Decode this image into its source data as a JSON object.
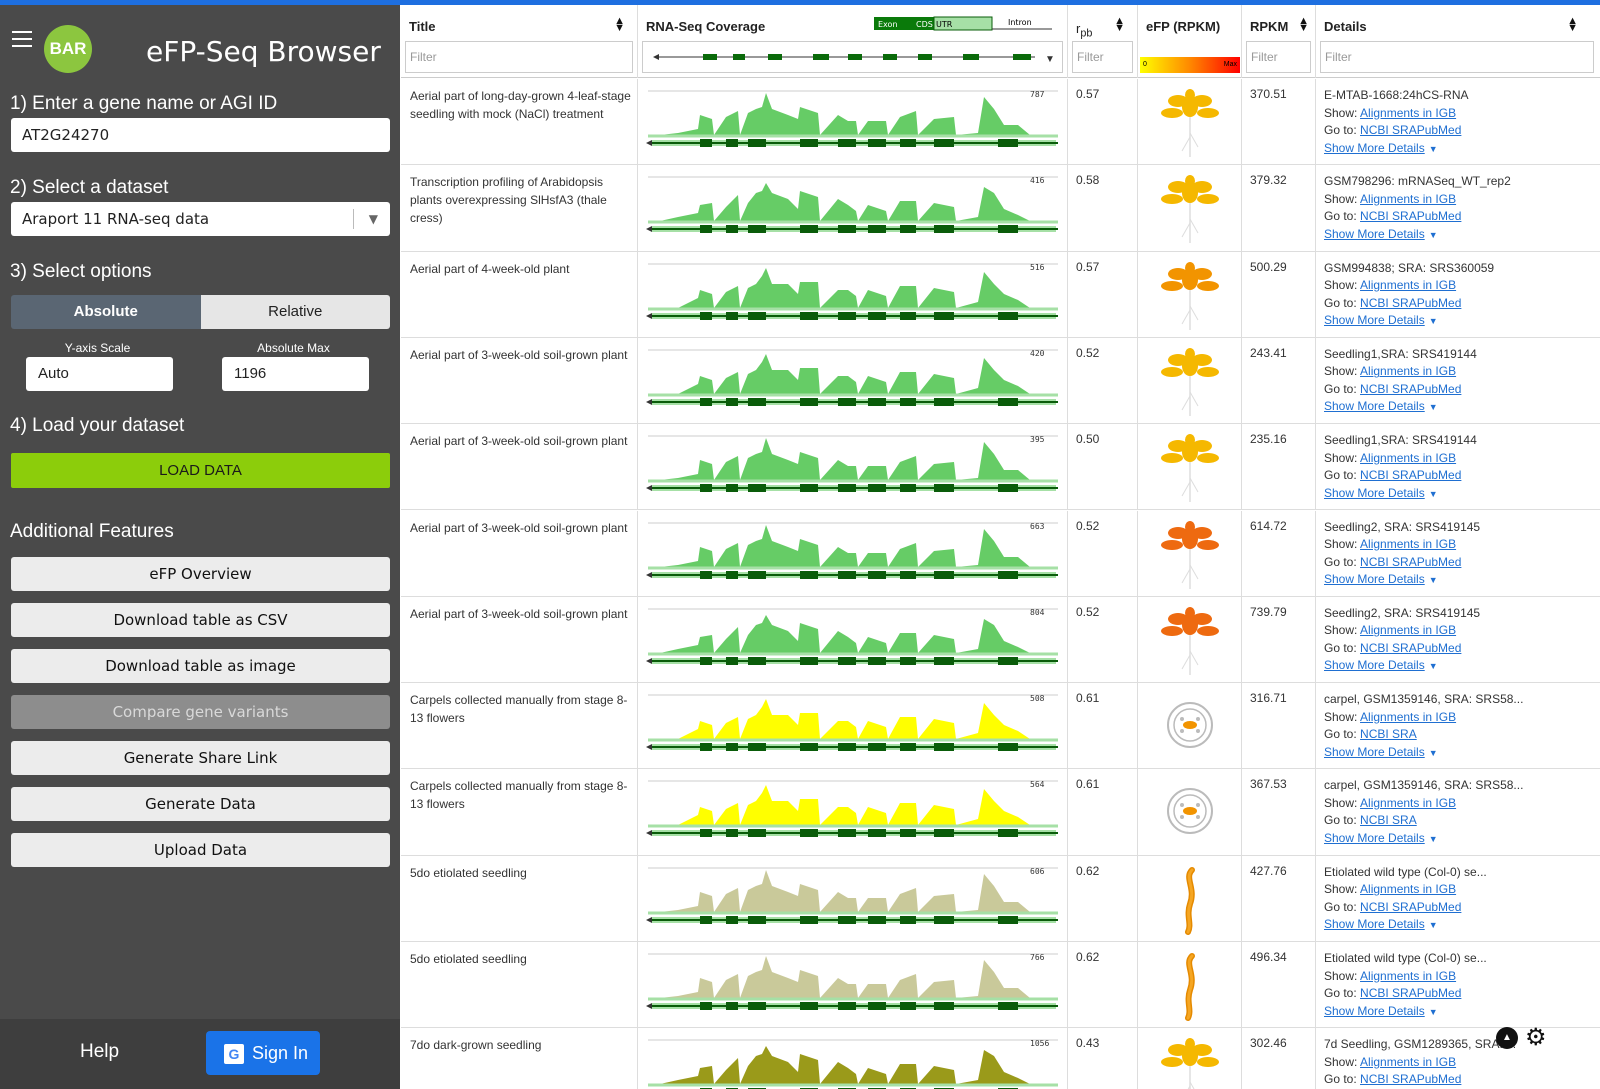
{
  "app": {
    "logo": "BAR",
    "title": "eFP-Seq Browser"
  },
  "steps": {
    "step1": "1) Enter a gene name or AGI ID",
    "gene_value": "AT2G24270",
    "step2": "2) Select a dataset",
    "dataset_value": "Araport 11 RNA-seq data",
    "step3": "3) Select options",
    "absolute": "Absolute",
    "relative": "Relative",
    "yaxis_label": "Y-axis Scale",
    "yaxis_value": "Auto",
    "absmax_label": "Absolute Max",
    "absmax_value": "1196",
    "step4": "4) Load your dataset",
    "load": "LOAD DATA"
  },
  "features": {
    "title": "Additional Features",
    "buttons": [
      "eFP Overview",
      "Download table as CSV",
      "Download table as image",
      "Compare gene variants",
      "Generate Share Link",
      "Generate Data",
      "Upload Data"
    ]
  },
  "footer": {
    "help": "Help",
    "signin": "Sign In",
    "g": "G"
  },
  "table": {
    "headers": {
      "title": "Title",
      "coverage": "RNA-Seq Coverage",
      "rpb": "r",
      "rpb_sub": "pb",
      "efp": "eFP (RPKM)",
      "rpkm": "RPKM",
      "details": "Details"
    },
    "filter_placeholder": "Filter",
    "legend": {
      "exon": "Exon",
      "cds": "CDS",
      "utr": "UTR",
      "intron": "Intron",
      "min": "0",
      "max": "Max"
    },
    "show_label": "Show:",
    "goto_label": "Go to:",
    "align_link": "Alignments in IGB",
    "more_link": "Show More Details",
    "colors": {
      "green": "#66cc66",
      "yellow": "#ffff00",
      "olive": "#c9c99a",
      "darkolive": "#9a9a1a",
      "gene": "#0a5c0a"
    },
    "rows": [
      {
        "title": "Aerial part of long-day-grown 4-leaf-stage seedling with mock (NaCl) treatment",
        "max": "787",
        "rpb": "0.57",
        "rpkm": "370.51",
        "d1": "E-MTAB-1668:24hCS-RNA",
        "goto": "NCBI SRAPubMed",
        "color": "green",
        "icon": "seedling-yellow-icon"
      },
      {
        "title": "Transcription profiling of Arabidopsis plants overexpressing SlHsfA3 (thale cress)",
        "max": "416",
        "rpb": "0.58",
        "rpkm": "379.32",
        "d1": "GSM798296: mRNASeq_WT_rep2",
        "goto": "NCBI SRAPubMed",
        "color": "green",
        "icon": "seedling-yellow-icon"
      },
      {
        "title": "Aerial part of 4-week-old plant",
        "max": "516",
        "rpb": "0.57",
        "rpkm": "500.29",
        "d1": "GSM994838; SRA: SRS360059",
        "goto": "NCBI SRAPubMed",
        "color": "green",
        "icon": "seedling-orange-icon"
      },
      {
        "title": "Aerial part of 3-week-old soil-grown plant",
        "max": "420",
        "rpb": "0.52",
        "rpkm": "243.41",
        "d1": "Seedling1,SRA: SRS419144",
        "goto": "NCBI SRAPubMed",
        "color": "green",
        "icon": "seedling-yellow-icon"
      },
      {
        "title": "Aerial part of 3-week-old soil-grown plant",
        "max": "395",
        "rpb": "0.50",
        "rpkm": "235.16",
        "d1": "Seedling1,SRA: SRS419144",
        "goto": "NCBI SRAPubMed",
        "color": "green",
        "icon": "seedling-yellow-icon"
      },
      {
        "title": "Aerial part of 3-week-old soil-grown plant",
        "max": "663",
        "rpb": "0.52",
        "rpkm": "614.72",
        "d1": "Seedling2, SRA: SRS419145",
        "goto": "NCBI SRAPubMed",
        "color": "green",
        "icon": "seedling-red-icon"
      },
      {
        "title": "Aerial part of 3-week-old soil-grown plant",
        "max": "804",
        "rpb": "0.52",
        "rpkm": "739.79",
        "d1": "Seedling2, SRA: SRS419145",
        "goto": "NCBI SRAPubMed",
        "color": "green",
        "icon": "seedling-red-icon"
      },
      {
        "title": "Carpels collected manually from stage 8-13 flowers",
        "max": "508",
        "rpb": "0.61",
        "rpkm": "316.71",
        "d1": "carpel, GSM1359146, SRA: SRS58...",
        "goto": "NCBI SRA",
        "color": "yellow",
        "icon": "carpel-icon"
      },
      {
        "title": "Carpels collected manually from stage 8-13 flowers",
        "max": "564",
        "rpb": "0.61",
        "rpkm": "367.53",
        "d1": "carpel, GSM1359146, SRA: SRS58...",
        "goto": "NCBI SRA",
        "color": "yellow",
        "icon": "carpel-icon"
      },
      {
        "title": "5do etiolated seedling",
        "max": "606",
        "rpb": "0.62",
        "rpkm": "427.76",
        "d1": "Etiolated wild type (Col-0) se...",
        "goto": "NCBI SRAPubMed",
        "color": "olive",
        "icon": "etiolated-seedling-icon"
      },
      {
        "title": "5do etiolated seedling",
        "max": "766",
        "rpb": "0.62",
        "rpkm": "496.34",
        "d1": "Etiolated wild type (Col-0) se...",
        "goto": "NCBI SRAPubMed",
        "color": "olive",
        "icon": "etiolated-seedling-icon"
      },
      {
        "title": "7do dark-grown seedling",
        "max": "1056",
        "rpb": "0.43",
        "rpkm": "302.46",
        "d1": "7d Seedling, GSM1289365, SRA: ...",
        "goto": "NCBI SRAPubMed",
        "color": "darkolive",
        "icon": "seedling-yellow-icon"
      }
    ]
  }
}
